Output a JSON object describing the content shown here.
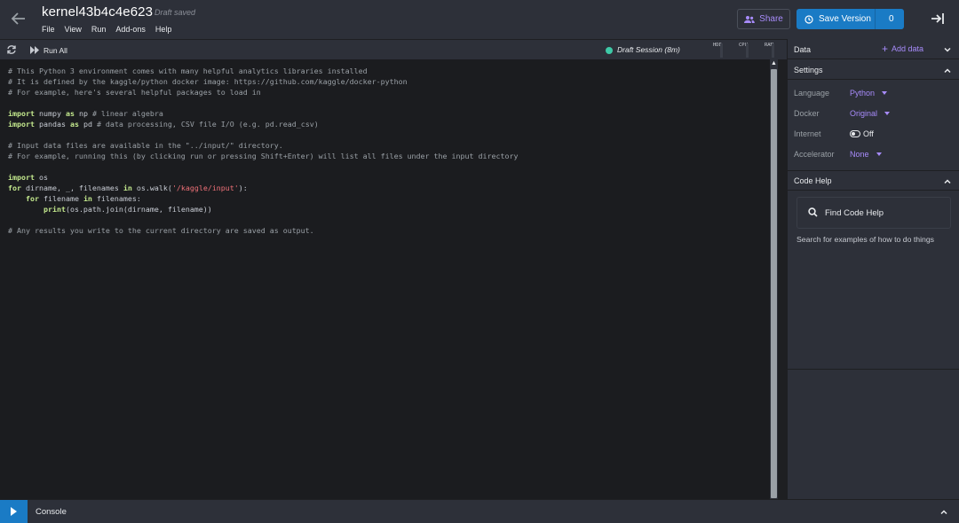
{
  "header": {
    "title": "kernel43b4c4e623",
    "status": "Draft saved",
    "menu": [
      "File",
      "View",
      "Run",
      "Add-ons",
      "Help"
    ],
    "share_label": "Share",
    "save_label": "Save Version",
    "save_count": "0"
  },
  "toolbar": {
    "run_all_label": "Run All",
    "session_label": "Draft Session  (8m)",
    "gauges": [
      "HDD",
      "CPU",
      "RAM"
    ]
  },
  "editor": {
    "lines": [
      [
        {
          "t": "# This Python 3 environment comes with many helpful analytics libraries installed",
          "c": "cm"
        }
      ],
      [
        {
          "t": "# It is defined by the kaggle/python docker image: https://github.com/kaggle/docker-python",
          "c": "cm"
        }
      ],
      [
        {
          "t": "# For example, here's several helpful packages to load in",
          "c": "cm"
        }
      ],
      [],
      [
        {
          "t": "import",
          "c": "kw"
        },
        {
          "t": " numpy "
        },
        {
          "t": "as",
          "c": "kw"
        },
        {
          "t": " np "
        },
        {
          "t": "# linear algebra",
          "c": "cm"
        }
      ],
      [
        {
          "t": "import",
          "c": "kw"
        },
        {
          "t": " pandas "
        },
        {
          "t": "as",
          "c": "kw"
        },
        {
          "t": " pd "
        },
        {
          "t": "# data processing, CSV file I/O (e.g. pd.read_csv)",
          "c": "cm"
        }
      ],
      [],
      [
        {
          "t": "# Input data files are available in the \"../input/\" directory.",
          "c": "cm"
        }
      ],
      [
        {
          "t": "# For example, running this (by clicking run or pressing Shift+Enter) will list all files under the input directory",
          "c": "cm"
        }
      ],
      [],
      [
        {
          "t": "import",
          "c": "kw"
        },
        {
          "t": " os"
        }
      ],
      [
        {
          "t": "for",
          "c": "kw"
        },
        {
          "t": " dirname, _, filenames "
        },
        {
          "t": "in",
          "c": "kw"
        },
        {
          "t": " os.walk("
        },
        {
          "t": "'/kaggle/input'",
          "c": "str"
        },
        {
          "t": "):"
        }
      ],
      [
        {
          "t": "    "
        },
        {
          "t": "for",
          "c": "kw"
        },
        {
          "t": " filename "
        },
        {
          "t": "in",
          "c": "kw"
        },
        {
          "t": " filenames:"
        }
      ],
      [
        {
          "t": "        "
        },
        {
          "t": "print",
          "c": "kw"
        },
        {
          "t": "(os.path.join(dirname, filename))"
        }
      ],
      [],
      [
        {
          "t": "# Any results you write to the current directory are saved as output.",
          "c": "cm"
        }
      ]
    ]
  },
  "sidebar": {
    "data_heading": "Data",
    "add_data_label": "Add data",
    "settings_heading": "Settings",
    "settings": {
      "language_label": "Language",
      "language_value": "Python",
      "docker_label": "Docker",
      "docker_value": "Original",
      "internet_label": "Internet",
      "internet_value": "Off",
      "accelerator_label": "Accelerator",
      "accelerator_value": "None"
    },
    "code_help_heading": "Code Help",
    "find_code_help_label": "Find Code Help",
    "code_help_desc": "Search for examples of how to do things"
  },
  "console": {
    "label": "Console"
  },
  "colors": {
    "accent_purple": "#a78bfa",
    "primary_blue": "#1a7bc5",
    "session_green": "#3ec9a7"
  }
}
